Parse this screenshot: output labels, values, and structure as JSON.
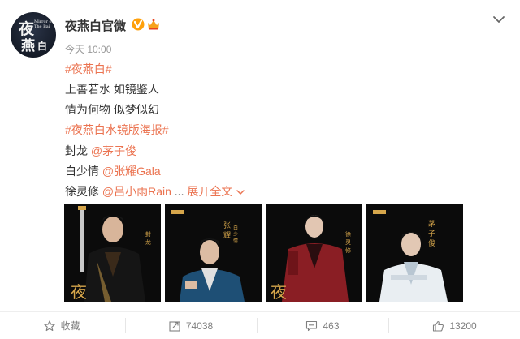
{
  "account": {
    "name": "夜燕白官微",
    "avatar_glyphs": [
      "夜",
      "燕",
      "白"
    ],
    "avatar_subtext": "Mirror of The Bai"
  },
  "post": {
    "time": "今天 10:00",
    "lines": {
      "tag1": "#夜燕白#",
      "line2": "上善若水 如镜鉴人",
      "line3": "情为何物 似梦似幻",
      "tag2": "#夜燕白水镜版海报#",
      "line5_prefix": "封龙 ",
      "line5_mention": "@茅子俊",
      "line6_prefix": "白少情 ",
      "line6_mention": "@张耀Gala",
      "line7_prefix": "徐灵修 ",
      "line7_mention": "@吕小雨Rain",
      "line7_ellipsis": " ... ",
      "expand_label": "展开全文"
    }
  },
  "actions": {
    "favorite": "收藏",
    "forward": "74038",
    "comment": "463",
    "like": "13200"
  },
  "colors": {
    "accent": "#eb7350",
    "text": "#333333",
    "muted": "#999999",
    "verified": "#ffa00a",
    "poster_bg": "#0c0c0c",
    "gold": "#d6a64b"
  },
  "icons": [
    "verified-icon",
    "vip-crown-icon",
    "chevron-down-icon",
    "star-icon",
    "forward-icon",
    "comment-icon",
    "like-icon"
  ]
}
